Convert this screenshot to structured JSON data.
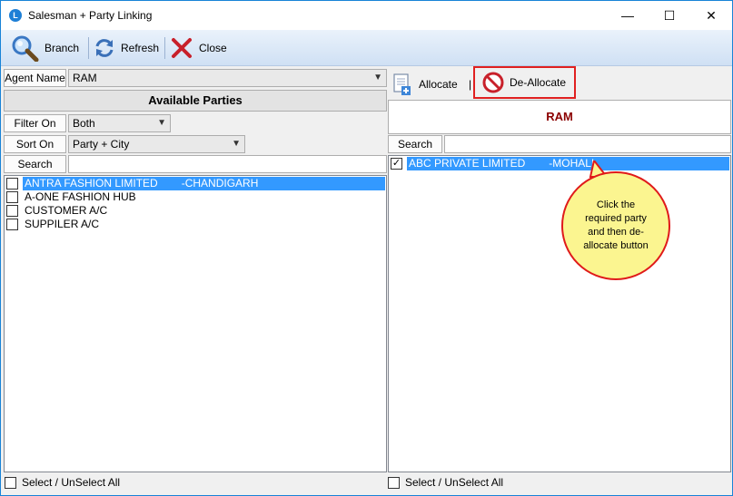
{
  "window": {
    "title": "Salesman + Party Linking",
    "controls": {
      "minimize": "—",
      "maximize": "☐",
      "close": "✕"
    }
  },
  "toolbar": {
    "branch_label": "Branch",
    "refresh_label": "Refresh",
    "close_label": "Close"
  },
  "agent": {
    "label": "Agent Name",
    "value": "RAM"
  },
  "left": {
    "header": "Available Parties",
    "filter_label": "Filter On",
    "filter_value": "Both",
    "sort_label": "Sort On",
    "sort_value": "Party + City",
    "search_label": "Search",
    "search_value": "",
    "items": [
      {
        "name": "ANTRA FASHION LIMITED",
        "city": "-CHANDIGARH",
        "selected": true,
        "checked": false
      },
      {
        "name": "A-ONE FASHION HUB",
        "city": "",
        "selected": false,
        "checked": false
      },
      {
        "name": "CUSTOMER A/C",
        "city": "",
        "selected": false,
        "checked": false
      },
      {
        "name": "SUPPILER A/C",
        "city": "",
        "selected": false,
        "checked": false
      }
    ],
    "select_all_label": "Select / UnSelect All"
  },
  "right": {
    "allocate_label": "Allocate",
    "separator": "|",
    "deallocate_label": "De-Allocate",
    "header": "RAM",
    "search_label": "Search",
    "search_value": "",
    "items": [
      {
        "name": "ABC PRIVATE LIMITED",
        "city": "-MOHALI",
        "selected": true,
        "checked": true,
        "check_glyph": "✓"
      }
    ],
    "select_all_label": "Select / UnSelect All"
  },
  "callout": {
    "text": "Click the required party and then de-allocate button"
  }
}
